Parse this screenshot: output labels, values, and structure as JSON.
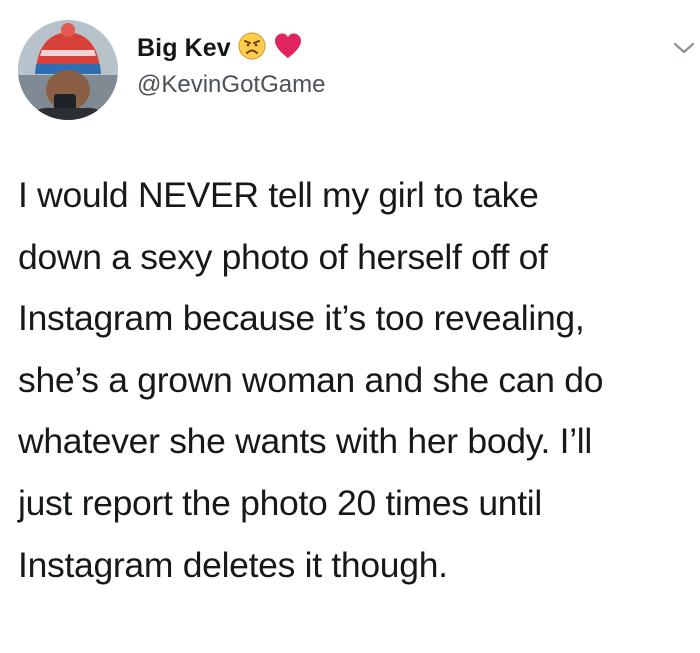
{
  "user": {
    "display_name": "Big Kev",
    "handle": "@KevinGotGame",
    "name_emojis": [
      "angry-face-icon",
      "red-heart-icon"
    ]
  },
  "tweet": {
    "text": "I would NEVER tell my girl to take\ndown a sexy photo of herself off of\nInstagram because it’s too revealing,\nshe’s a grown woman and she can do\nwhatever she wants with her body. I’ll\njust report the photo 20 times until\nInstagram deletes it though."
  },
  "colors": {
    "text": "#14171a",
    "handle": "#4b5259",
    "heart": "#e0245e",
    "background": "#ffffff"
  }
}
